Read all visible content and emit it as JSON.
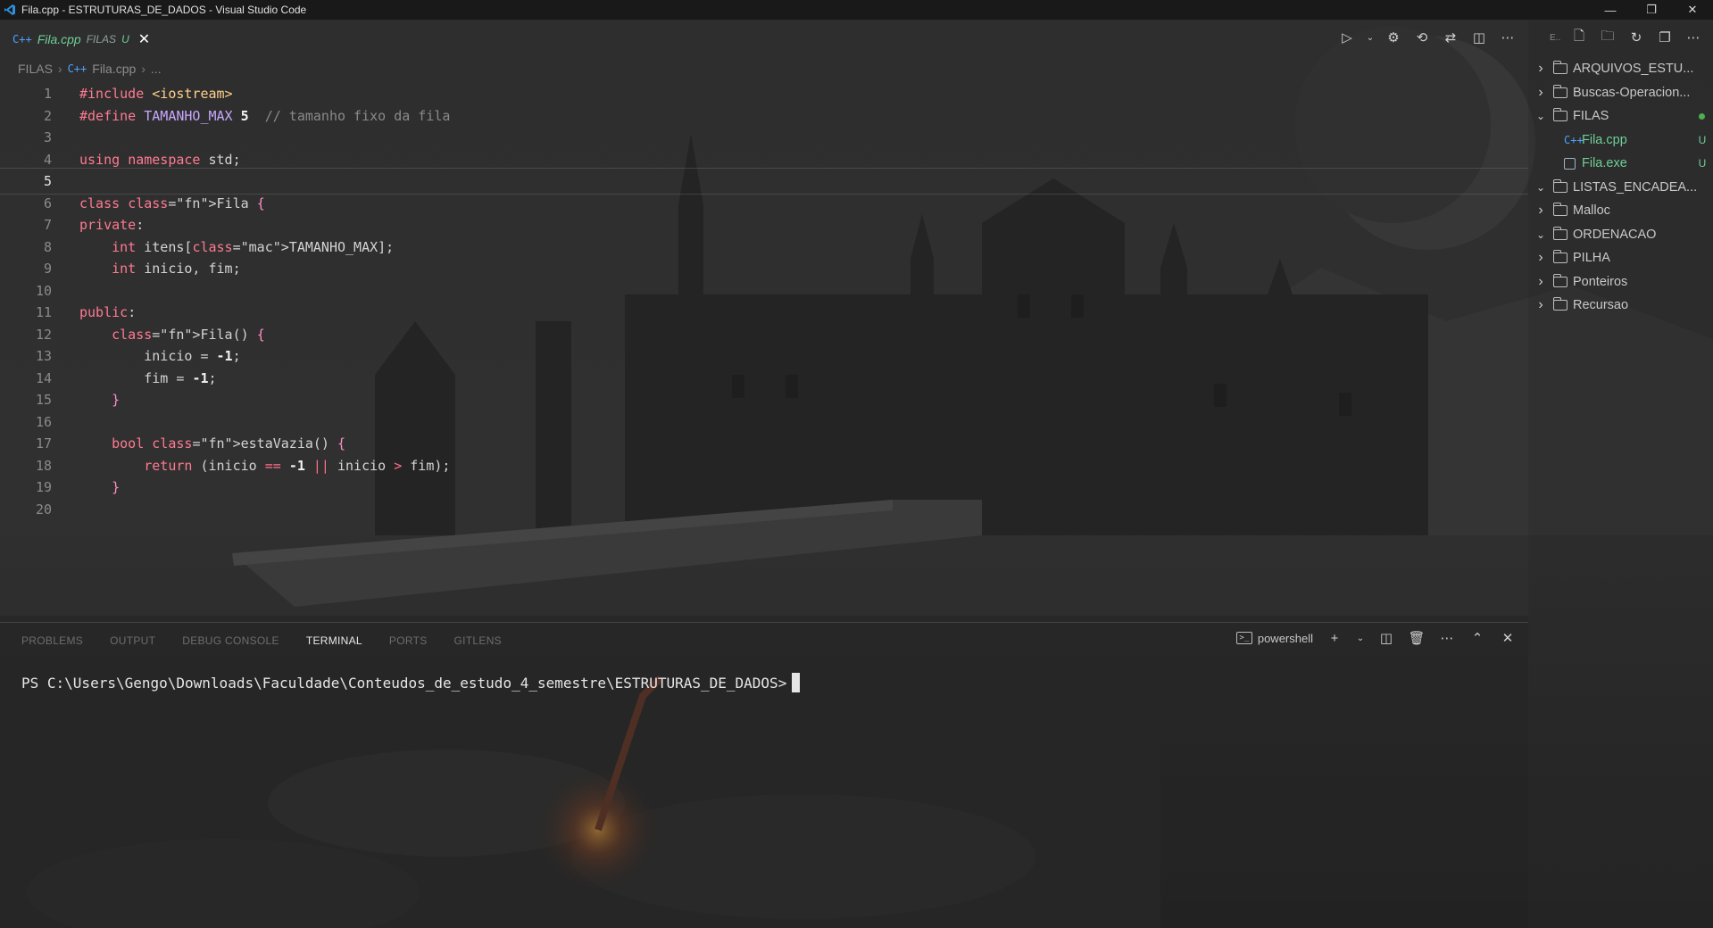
{
  "window": {
    "title": "Fila.cpp - ESTRUTURAS_DE_DADOS - Visual Studio Code"
  },
  "tab": {
    "icon": "C++",
    "name": "Fila.cpp",
    "folder": "FILAS",
    "status": "U"
  },
  "breadcrumb": {
    "folder": "FILAS",
    "file_icon": "C++",
    "file": "Fila.cpp",
    "more": "..."
  },
  "editor": {
    "active_line": 5,
    "line_numbers": [
      "1",
      "2",
      "3",
      "4",
      "5",
      "6",
      "7",
      "8",
      "9",
      "10",
      "11",
      "12",
      "13",
      "14",
      "15",
      "16",
      "17",
      "18",
      "19",
      "20"
    ],
    "lines": [
      "#include <iostream>",
      "#define TAMANHO_MAX 5  // tamanho fixo da fila",
      "",
      "using namespace std;",
      "",
      "class Fila {",
      "private:",
      "    int itens[TAMANHO_MAX];",
      "    int inicio, fim;",
      "",
      "public:",
      "    Fila() {",
      "        inicio = -1;",
      "        fim = -1;",
      "    }",
      "",
      "    bool estaVazia() {",
      "        return (inicio == -1 || inicio > fim);",
      "    }",
      ""
    ]
  },
  "panel": {
    "tabs": [
      "PROBLEMS",
      "OUTPUT",
      "DEBUG CONSOLE",
      "TERMINAL",
      "PORTS",
      "GITLENS"
    ],
    "active_tab": "TERMINAL",
    "shell": "powershell",
    "terminal_prompt": "PS C:\\Users\\Gengo\\Downloads\\Faculdade\\Conteudos_de_estudo_4_semestre\\ESTRUTURAS_DE_DADOS>"
  },
  "explorer": {
    "header_label": "E...",
    "tree": [
      {
        "name": "ARQUIVOS_ESTU...",
        "type": "folder",
        "expanded": false
      },
      {
        "name": "Buscas-Operacion...",
        "type": "folder",
        "expanded": false
      },
      {
        "name": "FILAS",
        "type": "folder",
        "expanded": true
      },
      {
        "name": "Fila.cpp",
        "type": "file-cpp",
        "status": "U",
        "icon": "C++"
      },
      {
        "name": "Fila.exe",
        "type": "file-exe",
        "status": "U"
      },
      {
        "name": "LISTAS_ENCADEA...",
        "type": "folder",
        "expanded": true
      },
      {
        "name": "Malloc",
        "type": "folder",
        "expanded": false
      },
      {
        "name": "ORDENACAO",
        "type": "folder",
        "expanded": true
      },
      {
        "name": "PILHA",
        "type": "folder",
        "expanded": false
      },
      {
        "name": "Ponteiros",
        "type": "folder",
        "expanded": false
      },
      {
        "name": "Recursao",
        "type": "folder",
        "expanded": false
      }
    ]
  },
  "colors": {
    "accent_green": "#6fcf97",
    "cpp_icon_blue": "#4aa3ff",
    "keyword_pink": "#ff7a92"
  }
}
